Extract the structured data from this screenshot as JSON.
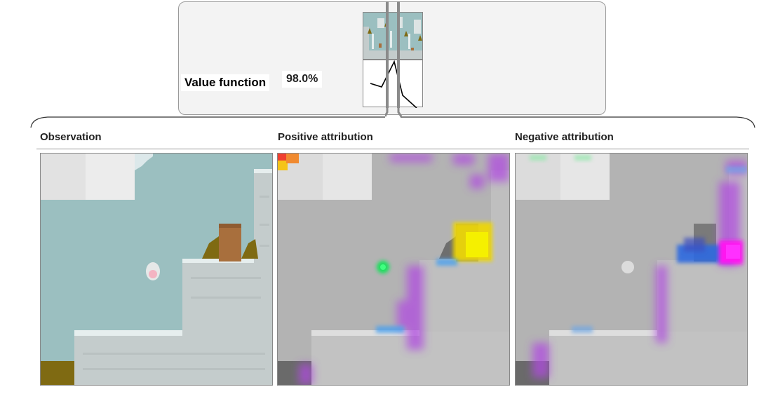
{
  "value_function": {
    "label": "Value function",
    "value": "98.0%"
  },
  "sections": {
    "observation": "Observation",
    "positive": "Positive attribution",
    "negative": "Negative attribution"
  },
  "colors": {
    "sky": "#9bbfc0",
    "stone": "#c4cccc",
    "stone_edge": "#e6eeee",
    "cloud": "#e4e4e4",
    "wood": "#a86f3d",
    "bush": "#7f6a12",
    "gray_bg": "#b3b3b3",
    "attr_purple": "#b04be0",
    "attr_yellow": "#f5f000",
    "attr_green": "#18e05a",
    "attr_blue": "#2f6be0",
    "attr_magenta": "#ff14f0"
  },
  "icons": {
    "scrub": "timeline-cursor-icon"
  }
}
